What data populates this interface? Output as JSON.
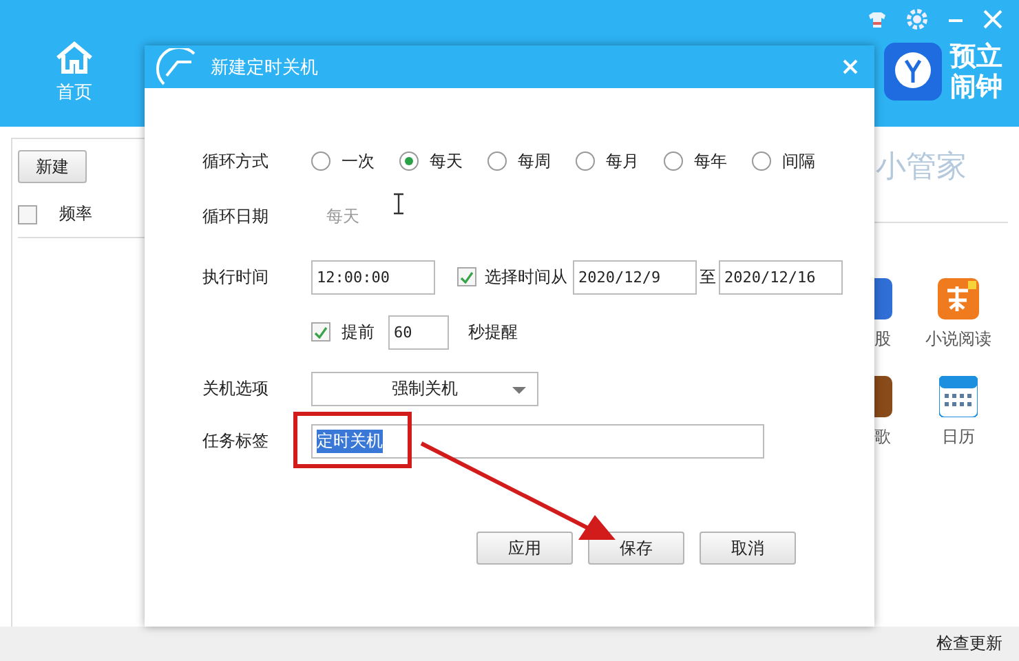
{
  "app": {
    "nav": [
      {
        "label": "首页",
        "selected": true
      }
    ],
    "brand": [
      "预立",
      "闹钟"
    ],
    "toolbar_buttons": [
      "新建"
    ],
    "list_header": {
      "checked": false,
      "columns": [
        "频率"
      ]
    },
    "promo_title": "小管家",
    "apps": [
      {
        "label": "股"
      },
      {
        "label": "小说阅读"
      },
      {
        "label": "歌"
      },
      {
        "label": "日历"
      }
    ],
    "status": "检查更新"
  },
  "dialog": {
    "title": "新建定时关机",
    "repeat_label": "循环方式",
    "repeat_options": [
      {
        "label": "一次",
        "selected": false
      },
      {
        "label": "每天",
        "selected": true
      },
      {
        "label": "每周",
        "selected": false
      },
      {
        "label": "每月",
        "selected": false
      },
      {
        "label": "每年",
        "selected": false
      },
      {
        "label": "间隔",
        "selected": false
      }
    ],
    "date_label": "循环日期",
    "date_value": "每天",
    "time_label": "执行时间",
    "time_value": "12:00:00",
    "range_checked": true,
    "range_label": "选择时间从",
    "range_from": "2020/12/9",
    "range_sep": "至",
    "range_to": "2020/12/16",
    "advance_checked": true,
    "advance_label": "提前",
    "advance_value": "60",
    "advance_suffix": "秒提醒",
    "shutdown_label": "关机选项",
    "shutdown_value": "强制关机",
    "tag_label": "任务标签",
    "tag_value": "定时关机",
    "tag_selected": true,
    "buttons": [
      "应用",
      "保存",
      "取消"
    ]
  }
}
